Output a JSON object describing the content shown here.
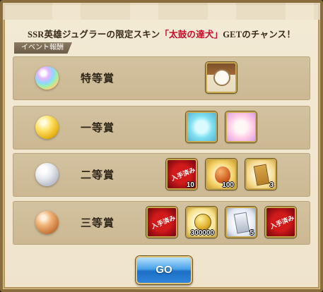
{
  "headline": {
    "before": "SSR英雄ジュグラーの限定スキン",
    "highlight": "「太鼓の達犬」",
    "after": "GETのチャンス！"
  },
  "section_tag": "イベント報酬",
  "tiers": [
    {
      "label": "特等賞",
      "orb": "rainbow-orb"
    },
    {
      "label": "一等賞",
      "orb": "gold-orb"
    },
    {
      "label": "二等賞",
      "orb": "silver-orb"
    },
    {
      "label": "三等賞",
      "orb": "bronze-orb"
    }
  ],
  "rewards": {
    "special": [
      {
        "icon": "hero-skin-icon",
        "qty": ""
      }
    ],
    "first": [
      {
        "icon": "rune-icon",
        "qty": ""
      },
      {
        "icon": "mystery-box-icon",
        "qty": ""
      }
    ],
    "second": [
      {
        "icon": "obtained-stamp-icon",
        "qty": "10",
        "stamp": "入手済み"
      },
      {
        "icon": "seed-icon",
        "qty": "100"
      },
      {
        "icon": "gold-scroll-icon",
        "qty": "3"
      }
    ],
    "third": [
      {
        "icon": "obtained-stamp-icon",
        "qty": "",
        "stamp": "入手済み"
      },
      {
        "icon": "gold-coin-icon",
        "qty": "300000"
      },
      {
        "icon": "silver-scroll-icon",
        "qty": "5"
      },
      {
        "icon": "obtained-stamp-icon",
        "qty": "",
        "stamp": "入手済み"
      }
    ]
  },
  "go_button": "GO"
}
